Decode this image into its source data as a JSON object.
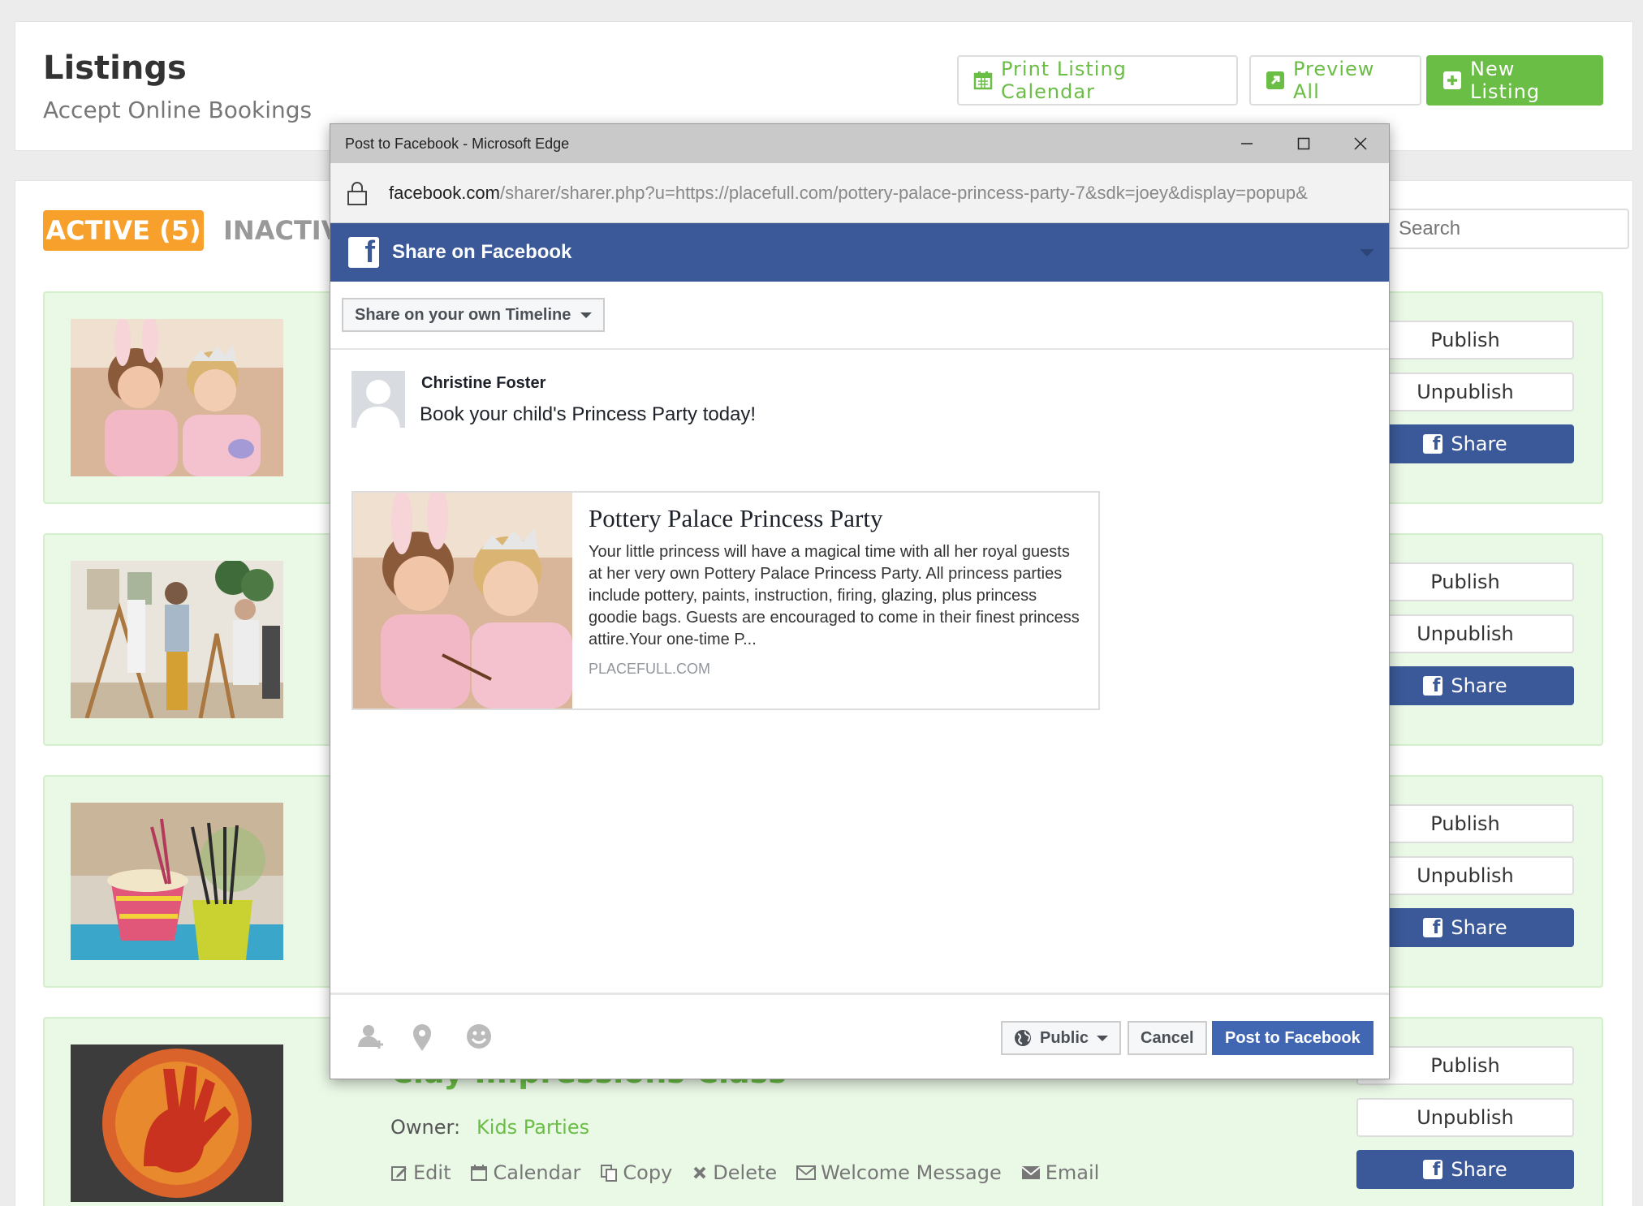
{
  "header": {
    "title": "Listings",
    "subtitle": "Accept Online Bookings",
    "print_calendar": "Print Listing Calendar",
    "preview_all": "Preview All",
    "new_listing": "New Listing"
  },
  "tabs": {
    "active": "ACTIVE (5)",
    "inactive": "INACTIVE"
  },
  "search": {
    "placeholder": "Search"
  },
  "listing_actions": {
    "publish": "Publish",
    "unpublish": "Unpublish",
    "share": "Share"
  },
  "visible_listing": {
    "title": "Clay Impressions Class",
    "owner_label": "Owner:",
    "owner_value": "Kids Parties",
    "links": [
      "Edit",
      "Calendar",
      "Copy",
      "Delete",
      "Welcome Message",
      "Email"
    ]
  },
  "dialog": {
    "window_title": "Post to Facebook - Microsoft Edge",
    "url_host": "facebook.com",
    "url_path": "/sharer/sharer.php?u=https://placefull.com/pottery-palace-princess-party-7&sdk=joey&display=popup&",
    "fb_header": "Share on Facebook",
    "timeline_select": "Share on your own Timeline",
    "poster_name": "Christine Foster",
    "message": "Book your child's Princess Party today!",
    "preview": {
      "title": "Pottery Palace Princess Party",
      "description": "Your little princess will have a magical time with all her royal guests at her very own Pottery Palace Princess Party. All  princess parties include pottery, paints, instruction, firing, glazing, plus princess goodie bags. Guests are encouraged to come in their finest princess attire.Your one-time P...",
      "domain": "PLACEFULL.COM"
    },
    "privacy": "Public",
    "cancel": "Cancel",
    "post": "Post to Facebook"
  },
  "colors": {
    "brand_green": "#6abd45",
    "tab_orange": "#f7a02c",
    "facebook_blue": "#3b5998",
    "fb_button_blue": "#4267b2",
    "listing_bg": "#eaf8e6"
  }
}
